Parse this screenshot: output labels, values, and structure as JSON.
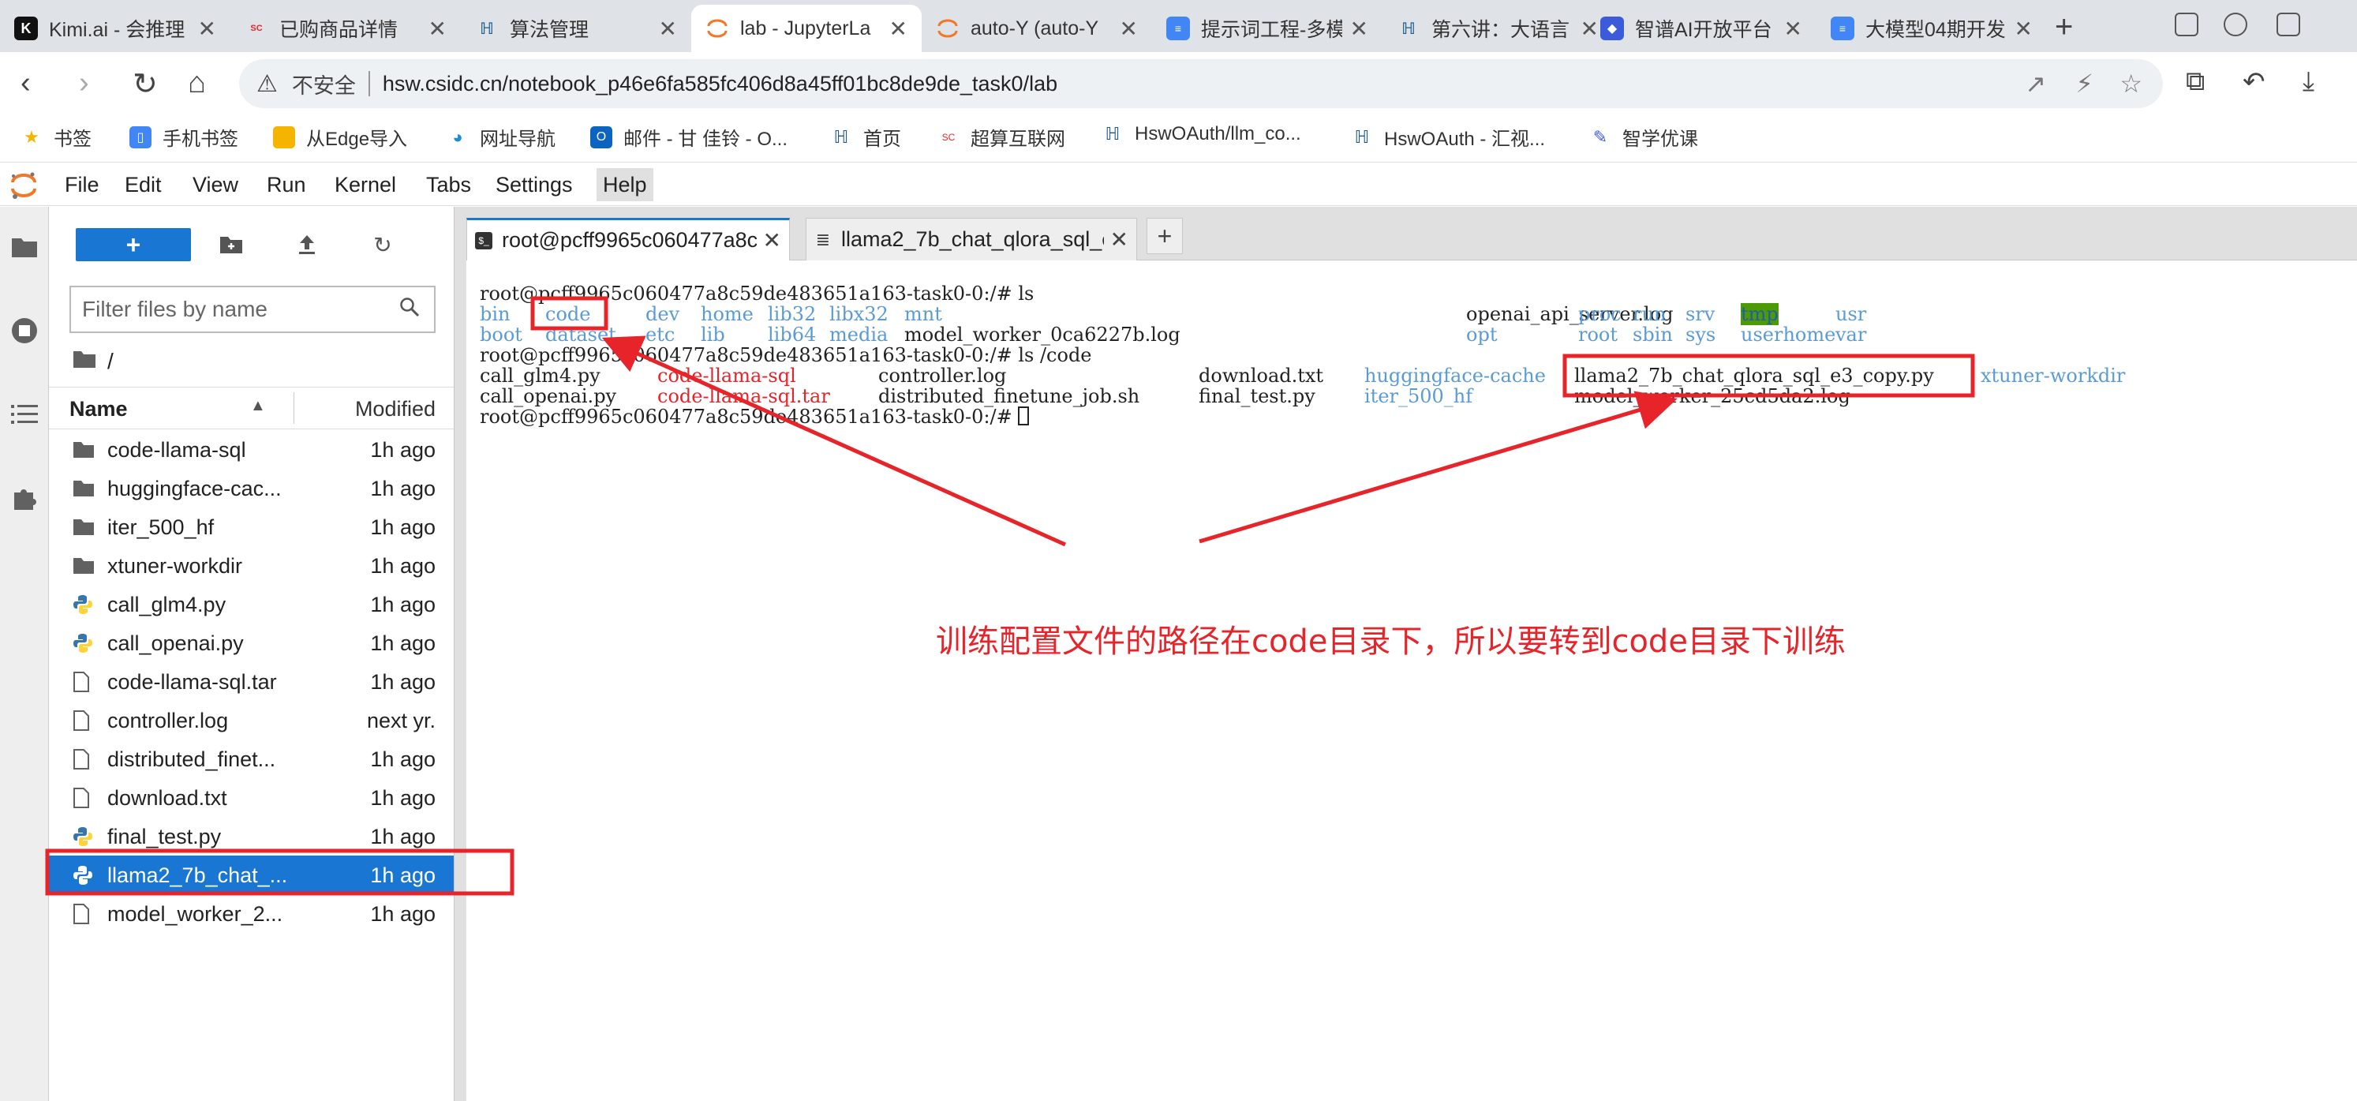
{
  "browser": {
    "tabs": [
      {
        "title": "Kimi.ai - 会推理",
        "favicon": "kimi-icon",
        "active": false
      },
      {
        "title": "已购商品详情",
        "favicon": "scnet-icon",
        "active": false
      },
      {
        "title": "算法管理",
        "favicon": "hsw-icon",
        "active": false
      },
      {
        "title": "lab - JupyterLa",
        "favicon": "jupyter-icon",
        "active": true
      },
      {
        "title": "auto-Y (auto-Y",
        "favicon": "jupyter-icon",
        "active": false
      },
      {
        "title": "提示词工程-多模",
        "favicon": "doc-icon",
        "active": false
      },
      {
        "title": "第六讲：大语言",
        "favicon": "hsw-icon",
        "active": false
      },
      {
        "title": "智谱AI开放平台",
        "favicon": "zhipu-icon",
        "active": false
      },
      {
        "title": "大模型04期开发",
        "favicon": "doc-icon",
        "active": false
      }
    ],
    "address": {
      "security_label": "不安全",
      "url": "hsw.csidc.cn/notebook_p46e6fa585fc406d8a45ff01bc8de9de_task0/lab"
    },
    "bookmarks": [
      {
        "label": "书签",
        "icon": "star-icon"
      },
      {
        "label": "手机书签",
        "icon": "phone-icon"
      },
      {
        "label": "从Edge导入",
        "icon": "folder-icon"
      },
      {
        "label": "网址导航",
        "icon": "edge-icon"
      },
      {
        "label": "邮件 - 甘 佳铃 - O...",
        "icon": "outlook-icon"
      },
      {
        "label": "首页",
        "icon": "hsw-icon"
      },
      {
        "label": "超算互联网",
        "icon": "scnet-icon"
      },
      {
        "label": "HswOAuth/llm_co...",
        "icon": "hsw-icon"
      },
      {
        "label": "HswOAuth - 汇视...",
        "icon": "hsw-icon"
      },
      {
        "label": "智学优课",
        "icon": "zhixue-icon"
      }
    ]
  },
  "jupyter": {
    "menu": [
      "File",
      "Edit",
      "View",
      "Run",
      "Kernel",
      "Tabs",
      "Settings",
      "Help"
    ],
    "active_menu": "Help",
    "file_browser": {
      "new_label": "+",
      "filter_placeholder": "Filter files by name",
      "path": "/",
      "header": {
        "name": "Name",
        "modified": "Modified"
      },
      "files": [
        {
          "name": "code-llama-sql",
          "type": "folder",
          "modified": "1h ago"
        },
        {
          "name": "huggingface-cac...",
          "type": "folder",
          "modified": "1h ago"
        },
        {
          "name": "iter_500_hf",
          "type": "folder",
          "modified": "1h ago"
        },
        {
          "name": "xtuner-workdir",
          "type": "folder",
          "modified": "1h ago"
        },
        {
          "name": "call_glm4.py",
          "type": "python",
          "modified": "1h ago"
        },
        {
          "name": "call_openai.py",
          "type": "python",
          "modified": "1h ago"
        },
        {
          "name": "code-llama-sql.tar",
          "type": "file",
          "modified": "1h ago"
        },
        {
          "name": "controller.log",
          "type": "file",
          "modified": "next yr."
        },
        {
          "name": "distributed_finet...",
          "type": "file",
          "modified": "1h ago"
        },
        {
          "name": "download.txt",
          "type": "file",
          "modified": "1h ago"
        },
        {
          "name": "final_test.py",
          "type": "python",
          "modified": "1h ago"
        },
        {
          "name": "llama2_7b_chat_...",
          "type": "python",
          "modified": "1h ago",
          "selected": true
        },
        {
          "name": "model_worker_2...",
          "type": "file",
          "modified": "1h ago"
        }
      ]
    },
    "dock_tabs": [
      {
        "label": "root@pcff9965c060477a8c",
        "icon": "terminal-icon",
        "active": true
      },
      {
        "label": "llama2_7b_chat_qlora_sql_e",
        "icon": "text-file-icon",
        "active": false
      }
    ],
    "terminal": {
      "prompt1": "root@pcff9965c060477a8c59de483651a163-task0-0:/# ls",
      "ls_row1": [
        "bin",
        "code",
        "dev",
        "home",
        "lib32",
        "libx32",
        "mnt",
        "openai_api_server.log",
        "proc",
        "run",
        "srv",
        "tmp",
        "usr"
      ],
      "ls_row2": [
        "boot",
        "dataset",
        "etc",
        "lib",
        "lib64",
        "media",
        "model_worker_0ca6227b.log",
        "opt",
        "root",
        "sbin",
        "sys",
        "userhome",
        "var"
      ],
      "prompt2": "root@pcff9965c060477a8c59de483651a163-task0-0:/# ls /code",
      "code_row1": [
        "call_glm4.py",
        "code-llama-sql",
        "controller.log",
        "download.txt",
        "huggingface-cache",
        "llama2_7b_chat_qlora_sql_e3_copy.py",
        "xtuner-workdir"
      ],
      "code_row2": [
        "call_openai.py",
        "code-llama-sql.tar",
        "distributed_finetune_job.sh",
        "final_test.py",
        "iter_500_hf",
        "model_worker_25cd5da2.log"
      ],
      "prompt3": "root@pcff9965c060477a8c59de483651a163-task0-0:/# "
    }
  },
  "annotation": {
    "text": "训练配置文件的路径在code目录下，所以要转到code目录下训练",
    "color": "#e6242a"
  }
}
